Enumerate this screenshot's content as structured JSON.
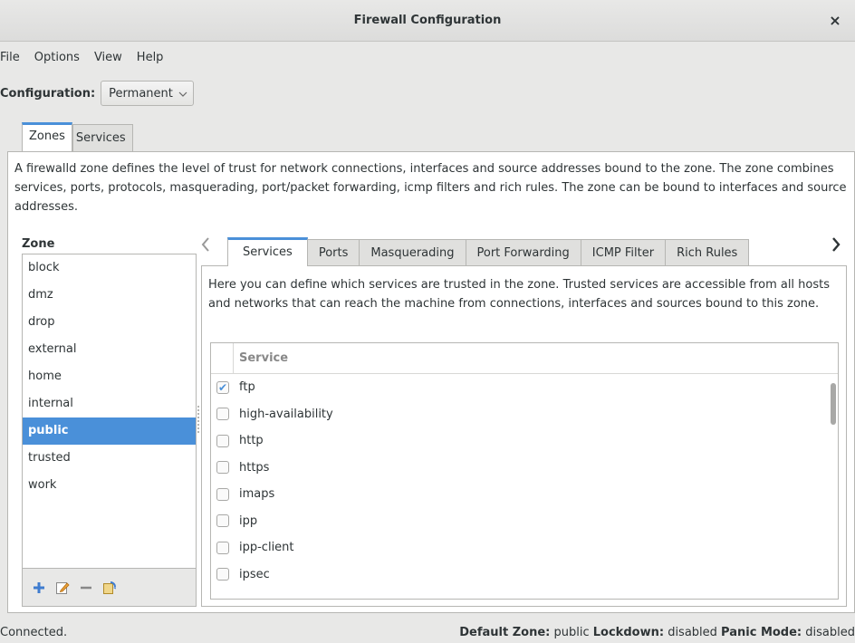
{
  "window": {
    "title": "Firewall Configuration",
    "close_glyph": "×"
  },
  "menu": [
    "File",
    "Options",
    "View",
    "Help"
  ],
  "configuration": {
    "label": "Configuration:",
    "value": "Permanent"
  },
  "outer_tabs": [
    "Zones",
    "Services"
  ],
  "zones_description": "A firewalld zone defines the level of trust for network connections, interfaces and source addresses bound to the zone. The zone combines services, ports, protocols, masquerading, port/packet forwarding, icmp filters and rich rules. The zone can be bound to interfaces and source addresses.",
  "zone_list": {
    "label": "Zone",
    "items": [
      "block",
      "dmz",
      "drop",
      "external",
      "home",
      "internal",
      "public",
      "trusted",
      "work"
    ],
    "selected": "public"
  },
  "zone_toolbar": [
    "add-icon",
    "edit-icon",
    "remove-icon",
    "load-defaults-icon"
  ],
  "inner_tabs": [
    "Services",
    "Ports",
    "Masquerading",
    "Port Forwarding",
    "ICMP Filter",
    "Rich Rules"
  ],
  "services_description": "Here you can define which services are trusted in the zone. Trusted services are accessible from all hosts and networks that can reach the machine from connections, interfaces and sources bound to this zone.",
  "services_table": {
    "header": "Service",
    "rows": [
      {
        "name": "ftp",
        "checked": true
      },
      {
        "name": "high-availability",
        "checked": false
      },
      {
        "name": "http",
        "checked": false
      },
      {
        "name": "https",
        "checked": false
      },
      {
        "name": "imaps",
        "checked": false
      },
      {
        "name": "ipp",
        "checked": false
      },
      {
        "name": "ipp-client",
        "checked": false
      },
      {
        "name": "ipsec",
        "checked": false
      }
    ]
  },
  "status": {
    "left": "Connected.",
    "default_zone_label": "Default Zone:",
    "default_zone_value": "public",
    "lockdown_label": "Lockdown:",
    "lockdown_value": "disabled",
    "panic_label": "Panic Mode:",
    "panic_value": "disabled"
  },
  "colors": {
    "accent": "#4a90d9",
    "selection": "#4a90d9"
  }
}
